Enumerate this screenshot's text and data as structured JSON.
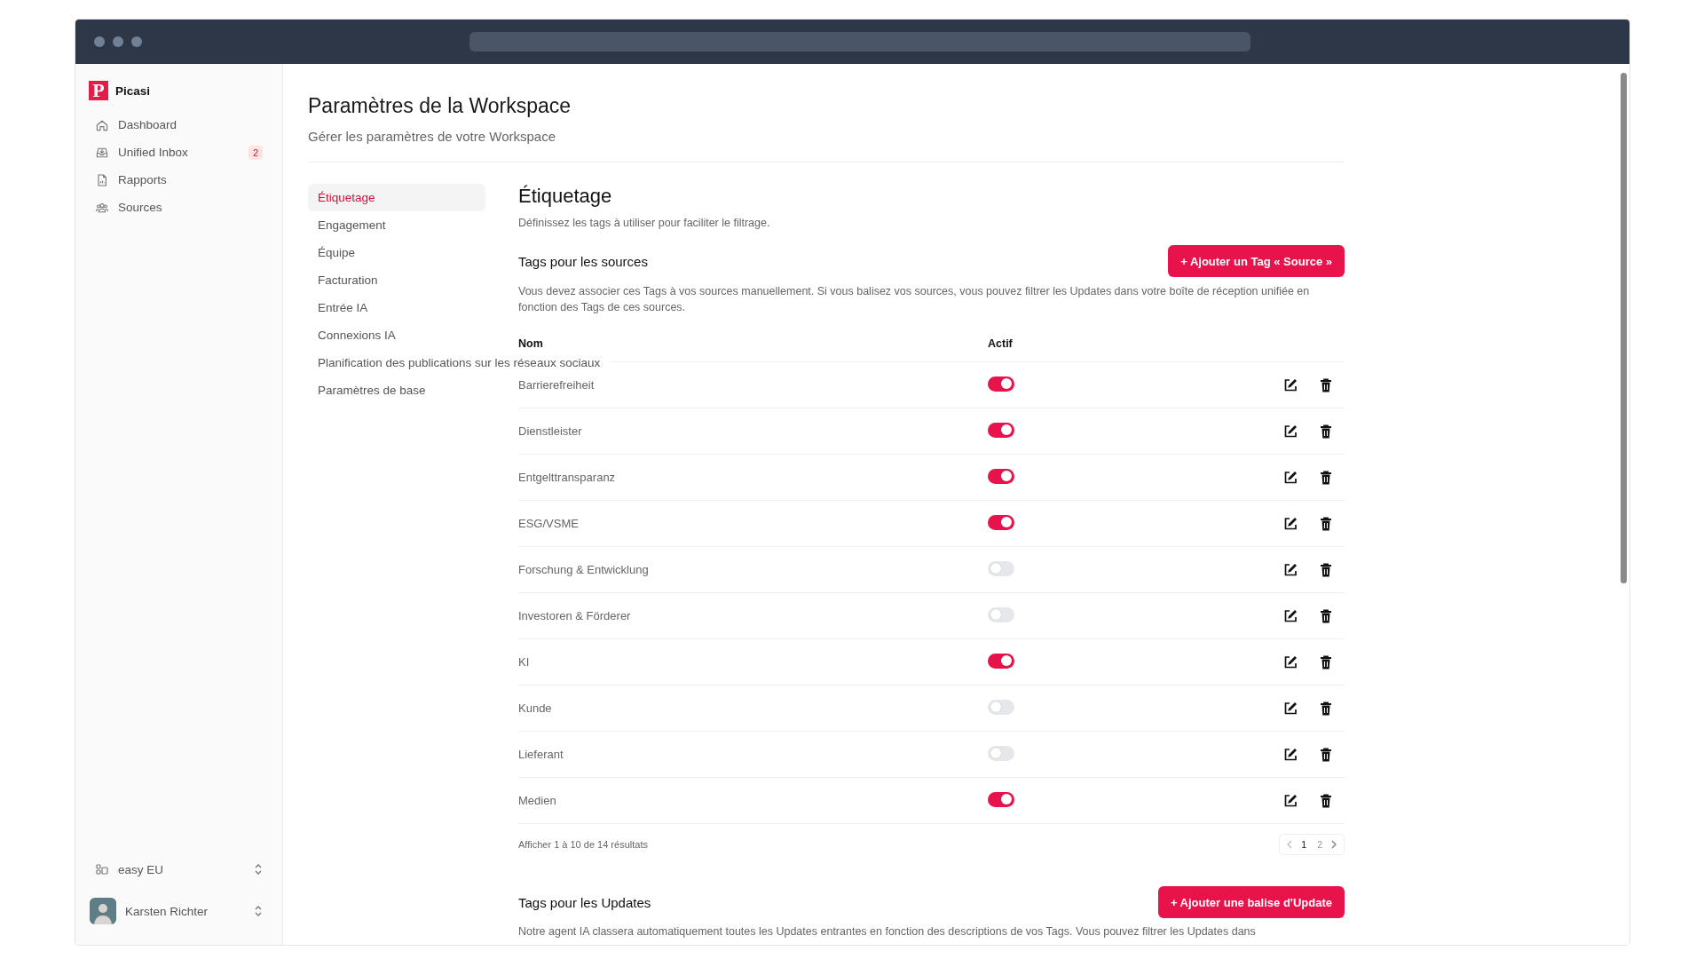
{
  "sidebar": {
    "brand": {
      "letter": "P",
      "name": "Picasi"
    },
    "items": [
      {
        "label": "Dashboard"
      },
      {
        "label": "Unified Inbox",
        "badge": "2"
      },
      {
        "label": "Rapports"
      },
      {
        "label": "Sources"
      }
    ],
    "workspace": {
      "label": "easy EU"
    },
    "user": {
      "name": "Karsten Richter"
    }
  },
  "page": {
    "title": "Paramètres de la Workspace",
    "subtitle": "Gérer les paramètres de votre Workspace"
  },
  "settings_nav": [
    {
      "label": "Étiquetage",
      "selected": true
    },
    {
      "label": "Engagement",
      "selected": false
    },
    {
      "label": "Équipe",
      "selected": false
    },
    {
      "label": "Facturation",
      "selected": false
    },
    {
      "label": "Entrée IA",
      "selected": false
    },
    {
      "label": "Connexions IA",
      "selected": false
    },
    {
      "label": "Planification des publications sur les réseaux sociaux",
      "selected": false
    },
    {
      "label": "Paramètres de base",
      "selected": false
    }
  ],
  "section": {
    "title": "Étiquetage",
    "description": "Définissez les tags à utiliser pour faciliter le filtrage."
  },
  "sources": {
    "title": "Tags pour les sources",
    "button": "+ Ajouter un Tag « Source »",
    "note": "Vous devez associer ces Tags à vos sources manuellement. Si vous balisez vos sources, vous pouvez filtrer les Updates dans votre boîte de réception unifiée en fonction des Tags de ces sources.",
    "columns": [
      "Nom",
      "Actif"
    ],
    "rows": [
      {
        "name": "Barrierefreiheit",
        "active": true
      },
      {
        "name": "Dienstleister",
        "active": true
      },
      {
        "name": "Entgelttransparanz",
        "active": true
      },
      {
        "name": "ESG/VSME",
        "active": true
      },
      {
        "name": "Forschung & Entwicklung",
        "active": false
      },
      {
        "name": "Investoren & Förderer",
        "active": false
      },
      {
        "name": "KI",
        "active": true
      },
      {
        "name": "Kunde",
        "active": false
      },
      {
        "name": "Lieferant",
        "active": false
      },
      {
        "name": "Medien",
        "active": true
      }
    ],
    "pagination": {
      "summary": "Afficher 1 à 10 de 14 résultats",
      "pages": [
        {
          "label": "1",
          "selected": true
        },
        {
          "label": "2",
          "selected": false
        }
      ]
    }
  },
  "updates": {
    "title": "Tags pour les Updates",
    "button": "+ Ajouter une balise d'Update",
    "note": "Notre agent IA classera automatiquement toutes les Updates entrantes en fonction des descriptions de vos Tags. Vous pouvez filtrer les Updates dans"
  }
}
